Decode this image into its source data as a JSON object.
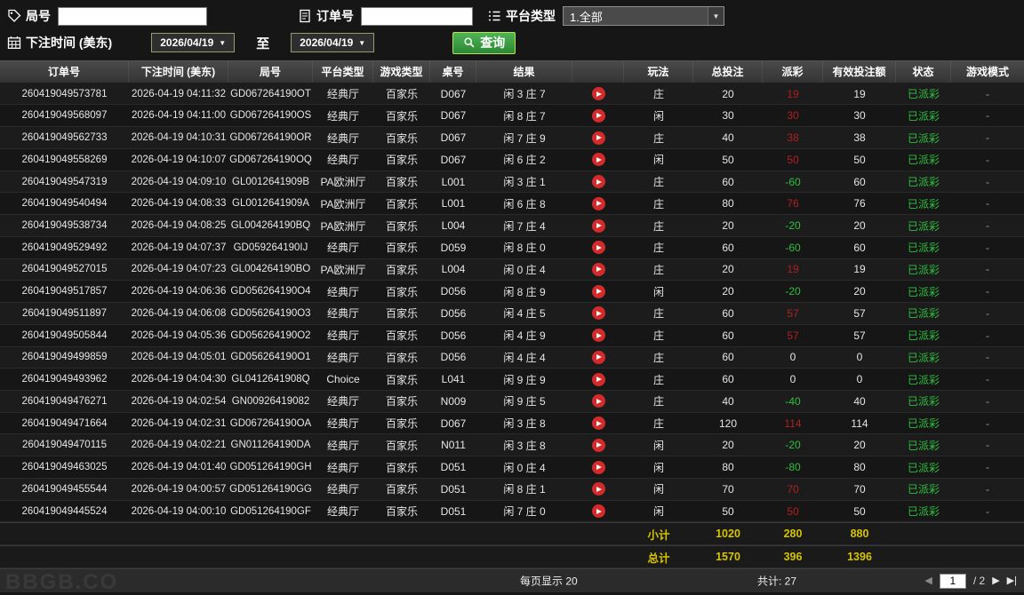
{
  "filters": {
    "game_no_label": "局号",
    "order_no_label": "订单号",
    "platform_type_label": "平台类型",
    "platform_type_value": "1.全部",
    "bet_time_label": "下注时间 (美东)",
    "date_from": "2026/04/19",
    "date_to": "2026/04/19",
    "to_label": "至",
    "query_label": "查询"
  },
  "icons": {
    "caret_down": "▼",
    "prev_icon": "◀",
    "next_icon": "▶",
    "last_icon": "▶|"
  },
  "colors": {
    "payout_positive": "#b02020",
    "payout_negative": "#2fbf3f",
    "status_green": "#2fbf3f",
    "summary_yellow": "#d8c300",
    "query_green": "#3fa347"
  },
  "table": {
    "headers": [
      "订单号",
      "下注时间 (美东)",
      "局号",
      "平台类型",
      "游戏类型",
      "桌号",
      "结果",
      "",
      "玩法",
      "总投注",
      "派彩",
      "有效投注额",
      "状态",
      "游戏模式"
    ],
    "rows": [
      {
        "order": "260419049573781",
        "time": "2026-04-19 04:11:32",
        "game": "GD067264190OT",
        "platform": "经典厅",
        "game_type": "百家乐",
        "table": "D067",
        "result": "闲 3 庄 7",
        "play": "庄",
        "total": "20",
        "payout": "19",
        "valid": "19",
        "status": "已派彩",
        "mode": "-"
      },
      {
        "order": "260419049568097",
        "time": "2026-04-19 04:11:00",
        "game": "GD067264190OS",
        "platform": "经典厅",
        "game_type": "百家乐",
        "table": "D067",
        "result": "闲 8 庄 7",
        "play": "闲",
        "total": "30",
        "payout": "30",
        "valid": "30",
        "status": "已派彩",
        "mode": "-"
      },
      {
        "order": "260419049562733",
        "time": "2026-04-19 04:10:31",
        "game": "GD067264190OR",
        "platform": "经典厅",
        "game_type": "百家乐",
        "table": "D067",
        "result": "闲 7 庄 9",
        "play": "庄",
        "total": "40",
        "payout": "38",
        "valid": "38",
        "status": "已派彩",
        "mode": "-"
      },
      {
        "order": "260419049558269",
        "time": "2026-04-19 04:10:07",
        "game": "GD067264190OQ",
        "platform": "经典厅",
        "game_type": "百家乐",
        "table": "D067",
        "result": "闲 6 庄 2",
        "play": "闲",
        "total": "50",
        "payout": "50",
        "valid": "50",
        "status": "已派彩",
        "mode": "-"
      },
      {
        "order": "260419049547319",
        "time": "2026-04-19 04:09:10",
        "game": "GL0012641909B",
        "platform": "PA欧洲厅",
        "game_type": "百家乐",
        "table": "L001",
        "result": "闲 3 庄 1",
        "play": "庄",
        "total": "60",
        "payout": "-60",
        "valid": "60",
        "status": "已派彩",
        "mode": "-"
      },
      {
        "order": "260419049540494",
        "time": "2026-04-19 04:08:33",
        "game": "GL0012641909A",
        "platform": "PA欧洲厅",
        "game_type": "百家乐",
        "table": "L001",
        "result": "闲 6 庄 8",
        "play": "庄",
        "total": "80",
        "payout": "76",
        "valid": "76",
        "status": "已派彩",
        "mode": "-"
      },
      {
        "order": "260419049538734",
        "time": "2026-04-19 04:08:25",
        "game": "GL004264190BQ",
        "platform": "PA欧洲厅",
        "game_type": "百家乐",
        "table": "L004",
        "result": "闲 7 庄 4",
        "play": "庄",
        "total": "20",
        "payout": "-20",
        "valid": "20",
        "status": "已派彩",
        "mode": "-"
      },
      {
        "order": "260419049529492",
        "time": "2026-04-19 04:07:37",
        "game": "GD059264190IJ",
        "platform": "经典厅",
        "game_type": "百家乐",
        "table": "D059",
        "result": "闲 8 庄 0",
        "play": "庄",
        "total": "60",
        "payout": "-60",
        "valid": "60",
        "status": "已派彩",
        "mode": "-"
      },
      {
        "order": "260419049527015",
        "time": "2026-04-19 04:07:23",
        "game": "GL004264190BO",
        "platform": "PA欧洲厅",
        "game_type": "百家乐",
        "table": "L004",
        "result": "闲 0 庄 4",
        "play": "庄",
        "total": "20",
        "payout": "19",
        "valid": "19",
        "status": "已派彩",
        "mode": "-"
      },
      {
        "order": "260419049517857",
        "time": "2026-04-19 04:06:36",
        "game": "GD056264190O4",
        "platform": "经典厅",
        "game_type": "百家乐",
        "table": "D056",
        "result": "闲 8 庄 9",
        "play": "闲",
        "total": "20",
        "payout": "-20",
        "valid": "20",
        "status": "已派彩",
        "mode": "-"
      },
      {
        "order": "260419049511897",
        "time": "2026-04-19 04:06:08",
        "game": "GD056264190O3",
        "platform": "经典厅",
        "game_type": "百家乐",
        "table": "D056",
        "result": "闲 4 庄 5",
        "play": "庄",
        "total": "60",
        "payout": "57",
        "valid": "57",
        "status": "已派彩",
        "mode": "-"
      },
      {
        "order": "260419049505844",
        "time": "2026-04-19 04:05:36",
        "game": "GD056264190O2",
        "platform": "经典厅",
        "game_type": "百家乐",
        "table": "D056",
        "result": "闲 4 庄 9",
        "play": "庄",
        "total": "60",
        "payout": "57",
        "valid": "57",
        "status": "已派彩",
        "mode": "-"
      },
      {
        "order": "260419049499859",
        "time": "2026-04-19 04:05:01",
        "game": "GD056264190O1",
        "platform": "经典厅",
        "game_type": "百家乐",
        "table": "D056",
        "result": "闲 4 庄 4",
        "play": "庄",
        "total": "60",
        "payout": "0",
        "valid": "0",
        "status": "已派彩",
        "mode": "-"
      },
      {
        "order": "260419049493962",
        "time": "2026-04-19 04:04:30",
        "game": "GL0412641908Q",
        "platform": "Choice",
        "game_type": "百家乐",
        "table": "L041",
        "result": "闲 9 庄 9",
        "play": "庄",
        "total": "60",
        "payout": "0",
        "valid": "0",
        "status": "已派彩",
        "mode": "-"
      },
      {
        "order": "260419049476271",
        "time": "2026-04-19 04:02:54",
        "game": "GN00926419082",
        "platform": "经典厅",
        "game_type": "百家乐",
        "table": "N009",
        "result": "闲 9 庄 5",
        "play": "庄",
        "total": "40",
        "payout": "-40",
        "valid": "40",
        "status": "已派彩",
        "mode": "-"
      },
      {
        "order": "260419049471664",
        "time": "2026-04-19 04:02:31",
        "game": "GD067264190OA",
        "platform": "经典厅",
        "game_type": "百家乐",
        "table": "D067",
        "result": "闲 3 庄 8",
        "play": "庄",
        "total": "120",
        "payout": "114",
        "valid": "114",
        "status": "已派彩",
        "mode": "-"
      },
      {
        "order": "260419049470115",
        "time": "2026-04-19 04:02:21",
        "game": "GN011264190DA",
        "platform": "经典厅",
        "game_type": "百家乐",
        "table": "N011",
        "result": "闲 3 庄 8",
        "play": "闲",
        "total": "20",
        "payout": "-20",
        "valid": "20",
        "status": "已派彩",
        "mode": "-"
      },
      {
        "order": "260419049463025",
        "time": "2026-04-19 04:01:40",
        "game": "GD051264190GH",
        "platform": "经典厅",
        "game_type": "百家乐",
        "table": "D051",
        "result": "闲 0 庄 4",
        "play": "闲",
        "total": "80",
        "payout": "-80",
        "valid": "80",
        "status": "已派彩",
        "mode": "-"
      },
      {
        "order": "260419049455544",
        "time": "2026-04-19 04:00:57",
        "game": "GD051264190GG",
        "platform": "经典厅",
        "game_type": "百家乐",
        "table": "D051",
        "result": "闲 8 庄 1",
        "play": "闲",
        "total": "70",
        "payout": "70",
        "valid": "70",
        "status": "已派彩",
        "mode": "-"
      },
      {
        "order": "260419049445524",
        "time": "2026-04-19 04:00:10",
        "game": "GD051264190GF",
        "platform": "经典厅",
        "game_type": "百家乐",
        "table": "D051",
        "result": "闲 7 庄 0",
        "play": "闲",
        "total": "50",
        "payout": "50",
        "valid": "50",
        "status": "已派彩",
        "mode": "-"
      }
    ],
    "subtotal": {
      "label": "小计",
      "total": "1020",
      "payout": "280",
      "valid": "880"
    },
    "total": {
      "label": "总计",
      "total": "1570",
      "payout": "396",
      "valid": "1396"
    }
  },
  "footer": {
    "per_page": "每页显示 20",
    "total_count": "共计: 27",
    "page": "1",
    "page_total": "/ 2",
    "watermark": "BBGB.CO"
  }
}
